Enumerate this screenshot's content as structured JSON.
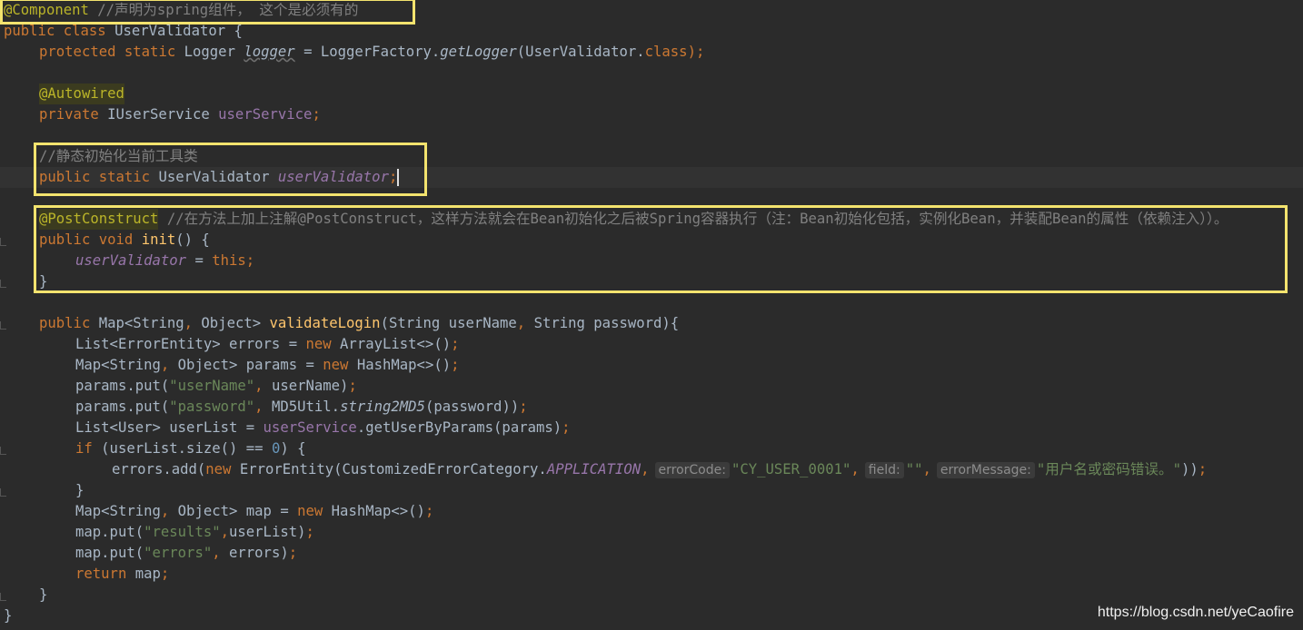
{
  "code": {
    "l1_annotation": "@Component",
    "l1_comment": " //声明为spring组件， 这个是必须有的",
    "l2_public": "public",
    "l2_class": "class",
    "l2_rest": " UserValidator {",
    "l3_protected": "protected",
    "l3_static": "static",
    "l3_type": " Logger ",
    "l3_var": "logger",
    "l3_mid": " = LoggerFactory.",
    "l3_fn": "getLogger",
    "l3_arg": "(UserValidator.",
    "l3_class": "class",
    "l3_end": ");",
    "l5_annotation": "@Autowired",
    "l6_private": "private",
    "l6_type": " IUserService ",
    "l6_field": "userService",
    "l6_semi": ";",
    "l8_comment": "//静态初始化当前工具类",
    "l9_public": "public",
    "l9_static": "static",
    "l9_type": " UserValidator ",
    "l9_field": "userValidator",
    "l9_semi": ";",
    "l11_annotation": "@PostConstruct",
    "l11_comment": " //在方法上加上注解@PostConstruct，这样方法就会在Bean初始化之后被Spring容器执行（注：Bean初始化包括，实例化Bean，并装配Bean的属性（依赖注入））。",
    "l12_public": "public",
    "l12_void": "void",
    "l12_fn": "init",
    "l12_rest": "() {",
    "l13_field": "userValidator",
    "l13_mid": " = ",
    "l13_this": "this",
    "l13_semi": ";",
    "l14_brace": "}",
    "l16_public": "public",
    "l16_type1": " Map<String",
    "l16_comma1": ",",
    "l16_type2": " Object> ",
    "l16_fn": "validateLogin",
    "l16_p1": "(String userName",
    "l16_comma2": ",",
    "l16_p2": " String password){",
    "l17_a": "List<ErrorEntity> errors = ",
    "l17_new": "new",
    "l17_b": " ArrayList<>()",
    "l17_semi": ";",
    "l18_a": "Map<String",
    "l18_comma": ",",
    "l18_b": " Object> params = ",
    "l18_new": "new",
    "l18_c": " HashMap<>()",
    "l18_semi": ";",
    "l19_a": "params.put(",
    "l19_str": "\"userName\"",
    "l19_comma": ",",
    "l19_b": " userName)",
    "l19_semi": ";",
    "l20_a": "params.put(",
    "l20_str": "\"password\"",
    "l20_comma": ",",
    "l20_b": " MD5Util.",
    "l20_fn": "string2MD5",
    "l20_c": "(password))",
    "l20_semi": ";",
    "l21_a": "List<User> userList = ",
    "l21_field": "userService",
    "l21_b": ".getUserByParams(params)",
    "l21_semi": ";",
    "l22_if": "if",
    "l22_a": " (userList.size() == ",
    "l22_num": "0",
    "l22_b": ") {",
    "l23_a": "errors.add(",
    "l23_new": "new",
    "l23_b": " ErrorEntity(CustomizedErrorCategory.",
    "l23_field": "APPLICATION",
    "l23_comma1": ",",
    "l23_hint1": "errorCode:",
    "l23_str1": "\"CY_USER_0001\"",
    "l23_comma2": ",",
    "l23_hint2": "field:",
    "l23_str2": "\"\"",
    "l23_comma3": ",",
    "l23_hint3": "errorMessage:",
    "l23_str3": "\"用户名或密码错误。\"",
    "l23_end": "))",
    "l23_semi": ";",
    "l24_brace": "}",
    "l25_a": "Map<String",
    "l25_comma": ",",
    "l25_b": " Object> map = ",
    "l25_new": "new",
    "l25_c": " HashMap<>()",
    "l25_semi": ";",
    "l26_a": "map.put(",
    "l26_str": "\"results\"",
    "l26_comma": ",",
    "l26_b": "userList)",
    "l26_semi": ";",
    "l27_a": "map.put(",
    "l27_str": "\"errors\"",
    "l27_comma": ",",
    "l27_b": " errors)",
    "l27_semi": ";",
    "l28_return": "return",
    "l28_a": " map",
    "l28_semi": ";",
    "l29_brace": "}",
    "l30_brace": "}"
  },
  "watermark": "https://blog.csdn.net/yeCaofire",
  "colors": {
    "background": "#2b2b2b",
    "keyword": "#cc7832",
    "annotation": "#bbb529",
    "comment": "#808080",
    "string": "#6a8759",
    "field": "#9876aa",
    "highlight_box": "#f3e36e"
  }
}
